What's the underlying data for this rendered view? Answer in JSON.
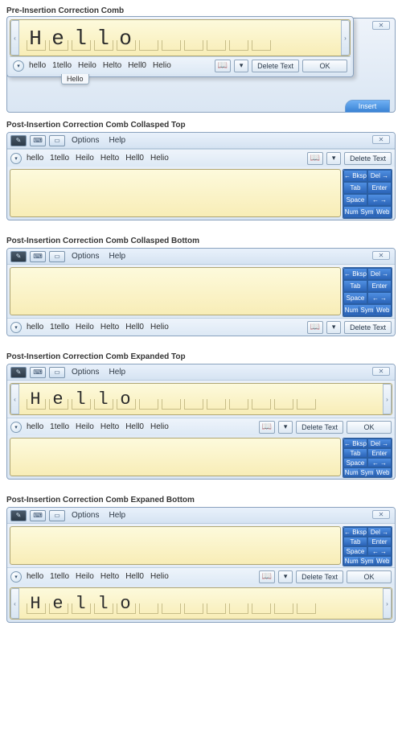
{
  "sections": {
    "s1": "Pre-Insertion Correction Comb",
    "s2": "Post-Insertion Correction Comb Collasped Top",
    "s3": "Post-Insertion Correction Comb Collasped Bottom",
    "s4": "Post-Insertion Correction Comb Expanded Top",
    "s5": "Post-Insertion Correction Comb Expaned Bottom"
  },
  "menu": {
    "options": "Options",
    "help": "Help"
  },
  "word": {
    "c0": "H",
    "c1": "e",
    "c2": "l",
    "c3": "l",
    "c4": "o"
  },
  "suggestions": {
    "a": "hello",
    "b": "1tello",
    "c": "Heilo",
    "d": "Helto",
    "e": "Hell0",
    "f": "Helio"
  },
  "popup_suggestion": "Hello",
  "buttons": {
    "delete_text": "Delete Text",
    "ok": "OK",
    "insert": "Insert",
    "close": "✕",
    "scroll_left": "‹",
    "scroll_right": "›",
    "expand": "▾",
    "tools": "▾",
    "book": "📖"
  },
  "osk": {
    "bksp": "← Bksp",
    "del": "Del →",
    "tab": "Tab",
    "enter": "Enter",
    "space": "Space",
    "left": "←",
    "right": "→",
    "num": "Num",
    "sym": "Sym",
    "web": "Web"
  }
}
